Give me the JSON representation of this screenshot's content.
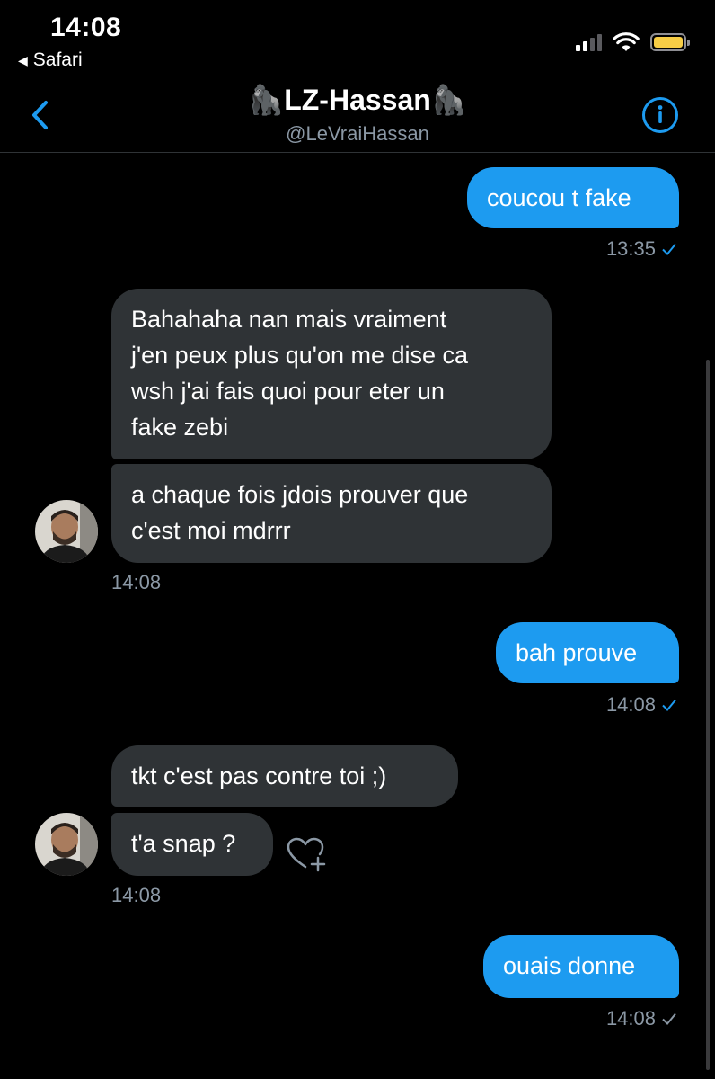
{
  "status_bar": {
    "time": "14:08",
    "back_app": "Safari",
    "battery_color": "#f7cd46"
  },
  "header": {
    "title": "🦍LZ-Hassan🦍",
    "handle": "@LeVraiHassan",
    "back_icon": "chevron-left-icon",
    "info_icon": "info-circle-icon",
    "accent": "#1d9bf0"
  },
  "messages": [
    {
      "id": "m1",
      "from": "me",
      "text": "coucou t fake",
      "time": "13:35",
      "status": "read"
    },
    {
      "id": "m2",
      "from": "them",
      "text": "Bahahaha nan mais vraiment\nj'en peux plus qu'on me dise ca\nwsh j'ai fais quoi pour eter un\nfake zebi"
    },
    {
      "id": "m3",
      "from": "them",
      "text": "a chaque fois jdois prouver que\nc'est moi mdrrr",
      "time": "14:08"
    },
    {
      "id": "m4",
      "from": "me",
      "text": "bah prouve",
      "time": "14:08",
      "status": "read"
    },
    {
      "id": "m5",
      "from": "them",
      "text": "tkt c'est pas contre toi ;)"
    },
    {
      "id": "m6",
      "from": "them",
      "text": "t'a snap ?",
      "time": "14:08"
    },
    {
      "id": "m7",
      "from": "me",
      "text": "ouais donne",
      "time": "14:08",
      "status": "sent"
    }
  ],
  "colors": {
    "sent_bubble": "#1d9bf0",
    "received_bubble": "#2f3336",
    "meta_text": "#8b98a5",
    "read_check": "#1d9bf0",
    "sent_check": "#8b98a5"
  }
}
